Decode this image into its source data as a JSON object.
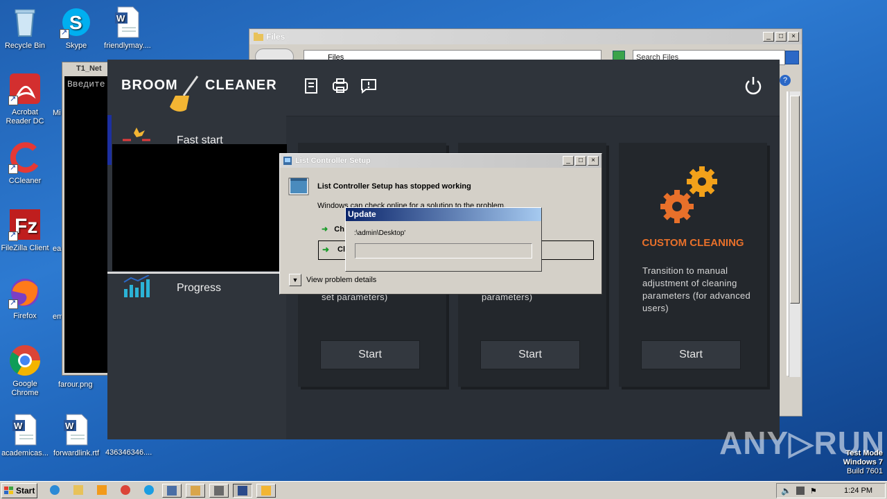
{
  "desktop": {
    "icons_col1": [
      {
        "label": "Recycle Bin",
        "icon": "recycle-bin-icon"
      },
      {
        "label": "Acrobat Reader DC",
        "icon": "acrobat-icon"
      },
      {
        "label": "CCleaner",
        "icon": "ccleaner-icon"
      },
      {
        "label": "FileZilla Client",
        "icon": "filezilla-icon"
      },
      {
        "label": "Firefox",
        "icon": "firefox-icon"
      },
      {
        "label": "Google Chrome",
        "icon": "chrome-icon"
      },
      {
        "label": "academicas...",
        "icon": "word-doc-icon"
      }
    ],
    "icons_col2": [
      {
        "label": "Skype",
        "icon": "skype-icon"
      },
      {
        "label": "Mi",
        "icon": "partial-icon"
      },
      {
        "label": "ea",
        "icon": "partial-icon"
      },
      {
        "label": "em",
        "icon": "partial-icon"
      },
      {
        "label": "farour.png",
        "icon": "image-icon"
      },
      {
        "label": "forwardlink.rtf",
        "icon": "word-doc-icon"
      }
    ],
    "icons_col3": [
      {
        "label": "friendlymay....",
        "icon": "word-doc-icon"
      },
      {
        "label": "436346346....",
        "icon": "partial-icon"
      }
    ]
  },
  "files_window": {
    "title": "Files",
    "address": "Files",
    "search_placeholder": "Search Files"
  },
  "console_window": {
    "title": "T1_Net",
    "text": "Введите"
  },
  "broom_cleaner": {
    "brand_left": "BROOM",
    "brand_right": "CLEANER",
    "sidebar": [
      {
        "label": "Fast start",
        "icon": "fast-start-icon"
      },
      {
        "label": "Progress",
        "icon": "progress-chart-icon"
      }
    ],
    "header_icons": [
      "report-icon",
      "printer-icon",
      "feedback-icon"
    ],
    "cards": [
      {
        "desc": "set parameters)",
        "start": "Start"
      },
      {
        "desc": "parameters)",
        "start": "Start"
      },
      {
        "title": "CUSTOM CLEANING",
        "desc": "Transition to manual adjustment of cleaning parameters (for advanced users)",
        "start": "Start"
      }
    ],
    "colors": {
      "accent": "#e8702a",
      "bg": "#2a2f36",
      "active_bar": "#1c2fa0"
    }
  },
  "crash_dialog": {
    "title": "List Controller Setup",
    "heading": "List Controller Setup has stopped working",
    "sub": "Windows can check online for a solution to the problem.",
    "option1": "Ch",
    "option2": "Cl",
    "details": "View problem details"
  },
  "update_dialog": {
    "title": "Update",
    "path": ":\\admin\\Desktop'"
  },
  "watermark": {
    "brand": "ANY▷RUN",
    "line1": "Test Mode",
    "line2": "Windows 7",
    "line3": "Build 7601"
  },
  "taskbar": {
    "start_label": "Start",
    "time": "1:24 PM",
    "items": [
      "ie-icon",
      "explorer-icon",
      "media-player-icon",
      "chrome-icon",
      "edge-icon",
      "network-icon",
      "control-panel-icon",
      "app-icon",
      "setup-icon",
      "broom-icon"
    ]
  }
}
